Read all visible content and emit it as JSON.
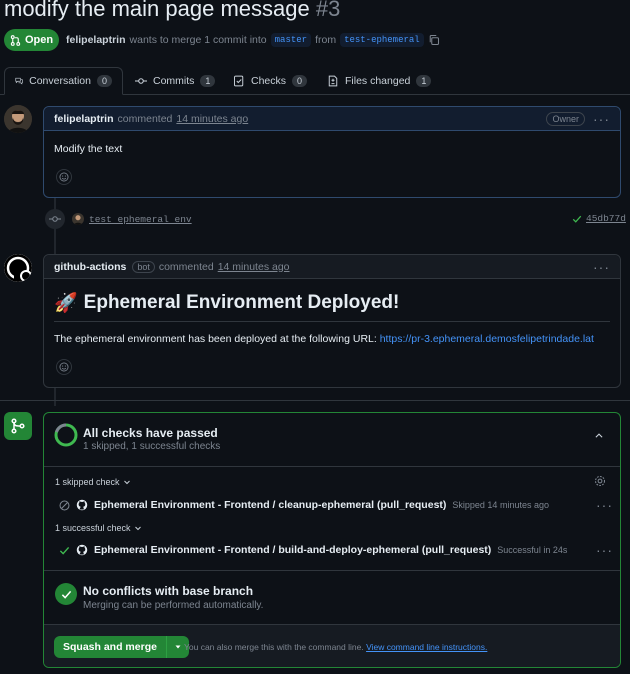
{
  "pr": {
    "title": "modify the main page message",
    "number": "#3",
    "state": "Open",
    "author": "felipelaptrin",
    "merge_text": "wants to merge 1 commit into",
    "base_branch": "master",
    "from_text": "from",
    "head_branch": "test-ephemeral"
  },
  "tabs": [
    {
      "label": "Conversation",
      "count": "0",
      "icon": "comment-discussion-icon"
    },
    {
      "label": "Commits",
      "count": "1",
      "icon": "git-commit-icon"
    },
    {
      "label": "Checks",
      "count": "0",
      "icon": "checklist-icon"
    },
    {
      "label": "Files changed",
      "count": "1",
      "icon": "file-diff-icon"
    }
  ],
  "comment1": {
    "author": "felipelaptrin",
    "action": "commented",
    "time": "14 minutes ago",
    "role": "Owner",
    "body": "Modify the text"
  },
  "commit": {
    "message": "test ephemeral env",
    "sha": "45db77d"
  },
  "comment2": {
    "author": "github-actions",
    "bot_label": "bot",
    "action": "commented",
    "time": "14 minutes ago",
    "heading": "Ephemeral Environment Deployed!",
    "heading_emoji": "🚀",
    "body": "The ephemeral environment has been deployed at the following URL:",
    "url": "https://pr-3.ephemeral.demosfelipetrindade.lat"
  },
  "checks": {
    "title": "All checks have passed",
    "subtitle": "1 skipped, 1 successful checks",
    "skipped_label": "1 skipped check",
    "skipped_name": "Ephemeral Environment - Frontend / cleanup-ephemeral (pull_request)",
    "skipped_note": "Skipped 14 minutes ago",
    "success_label": "1 successful check",
    "success_name": "Ephemeral Environment - Frontend / build-and-deploy-ephemeral (pull_request)",
    "success_note": "Successful in 24s"
  },
  "conflicts": {
    "title": "No conflicts with base branch",
    "subtitle": "Merging can be performed automatically."
  },
  "merge": {
    "button_label": "Squash and merge",
    "hint": "You can also merge this with the command line.",
    "link": "View command line instructions."
  },
  "colors": {
    "accent_green": "#238636",
    "link_blue": "#4493f8",
    "background": "#0d1117"
  }
}
